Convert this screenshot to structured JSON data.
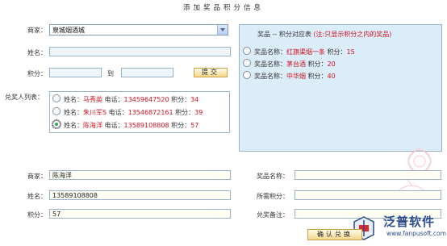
{
  "page": {
    "title": "添加奖品积分信息"
  },
  "form": {
    "merchant_label": "商家：",
    "merchant_value": "泉城烟酒城",
    "name_label": "姓名：",
    "points_label": "积分：",
    "to_label": "到",
    "submit_label": "提交"
  },
  "winners": {
    "label": "兑奖人列表：",
    "name_prefix": "姓名：",
    "phone_prefix": "电话：",
    "points_prefix": "积分：",
    "items": [
      {
        "name": "马秀英",
        "phone": "13459647520",
        "points": "34",
        "checked": false
      },
      {
        "name": "朱川军S",
        "phone": "13546872161",
        "points": "39",
        "checked": false
      },
      {
        "name": "陈海洋",
        "phone": "13589108808",
        "points": "57",
        "checked": true
      }
    ]
  },
  "prizes": {
    "title": "奖品 -- 积分对应表",
    "note": "(注:只显示积分之内的奖品)",
    "name_prefix": "奖品名称：",
    "points_prefix": "积分：",
    "items": [
      {
        "name": "红旗渠烟一条",
        "points": "15"
      },
      {
        "name": "茅台酒",
        "points": "20"
      },
      {
        "name": "中华烟",
        "points": "40"
      }
    ]
  },
  "detail": {
    "merchant_label": "商家：",
    "merchant_value": "陈海洋",
    "name_label": "姓名：",
    "name_value": "13589108808",
    "points_label": "积分：",
    "points_value": "57",
    "prize_name_label": "奖品名称：",
    "required_points_label": "所需积分：",
    "remark_label": "兑奖备注：",
    "confirm_label": "确认兑换"
  },
  "brand": {
    "name": "泛普软件",
    "url": "www.fanpusoft.com",
    "color": "#2c4c8c"
  },
  "colors": {
    "highlight_red": "#d0101e",
    "panel_bg": "#dcedfa",
    "input_bg": "#fffff4",
    "button_gold": "#f4d68a"
  }
}
